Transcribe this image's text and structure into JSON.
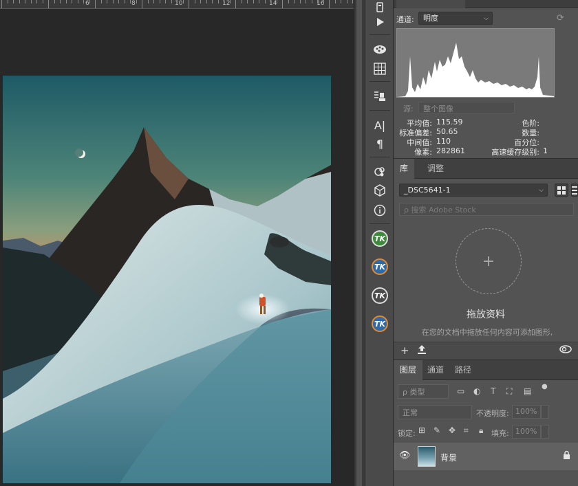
{
  "ruler": {
    "labels": [
      "6",
      "8",
      "10",
      "12",
      "14",
      "16"
    ]
  },
  "histogram": {
    "channel_label": "通道:",
    "channel_value": "明度",
    "source_label": "源:",
    "source_value": "整个图像",
    "stats_left": [
      {
        "label": "平均值:",
        "value": "115.59"
      },
      {
        "label": "标准偏差:",
        "value": "50.65"
      },
      {
        "label": "中间值:",
        "value": "110"
      },
      {
        "label": "像素:",
        "value": "282861"
      }
    ],
    "stats_right": [
      {
        "label": "色阶:",
        "value": ""
      },
      {
        "label": "数量:",
        "value": ""
      },
      {
        "label": "百分位:",
        "value": ""
      },
      {
        "label": "高速缓存级别:",
        "value": "1"
      }
    ]
  },
  "library": {
    "tabs": [
      "库",
      "调整"
    ],
    "selected_library": "_DSC5641-1",
    "search_placeholder": "搜索 Adobe Stock",
    "drop_title": "拖放资料",
    "drop_desc": "在您的文档中拖放任何内容可添加图形,",
    "plus_glyph": "+"
  },
  "layers": {
    "tabs": [
      "图层",
      "通道",
      "路径"
    ],
    "filter_label": "ρ 类型",
    "blend_mode": "正常",
    "opacity_label": "不透明度:",
    "opacity_value": "100%",
    "lock_label": "锁定:",
    "fill_label": "填充:",
    "fill_value": "100%",
    "layer_name": "背景"
  },
  "tools": {
    "tk_label": "TK"
  },
  "colors": {
    "panel_bg": "#535353",
    "canvas_bg": "#282828",
    "accent_green": "#3c8a3a",
    "accent_orange": "#e58a2e"
  }
}
